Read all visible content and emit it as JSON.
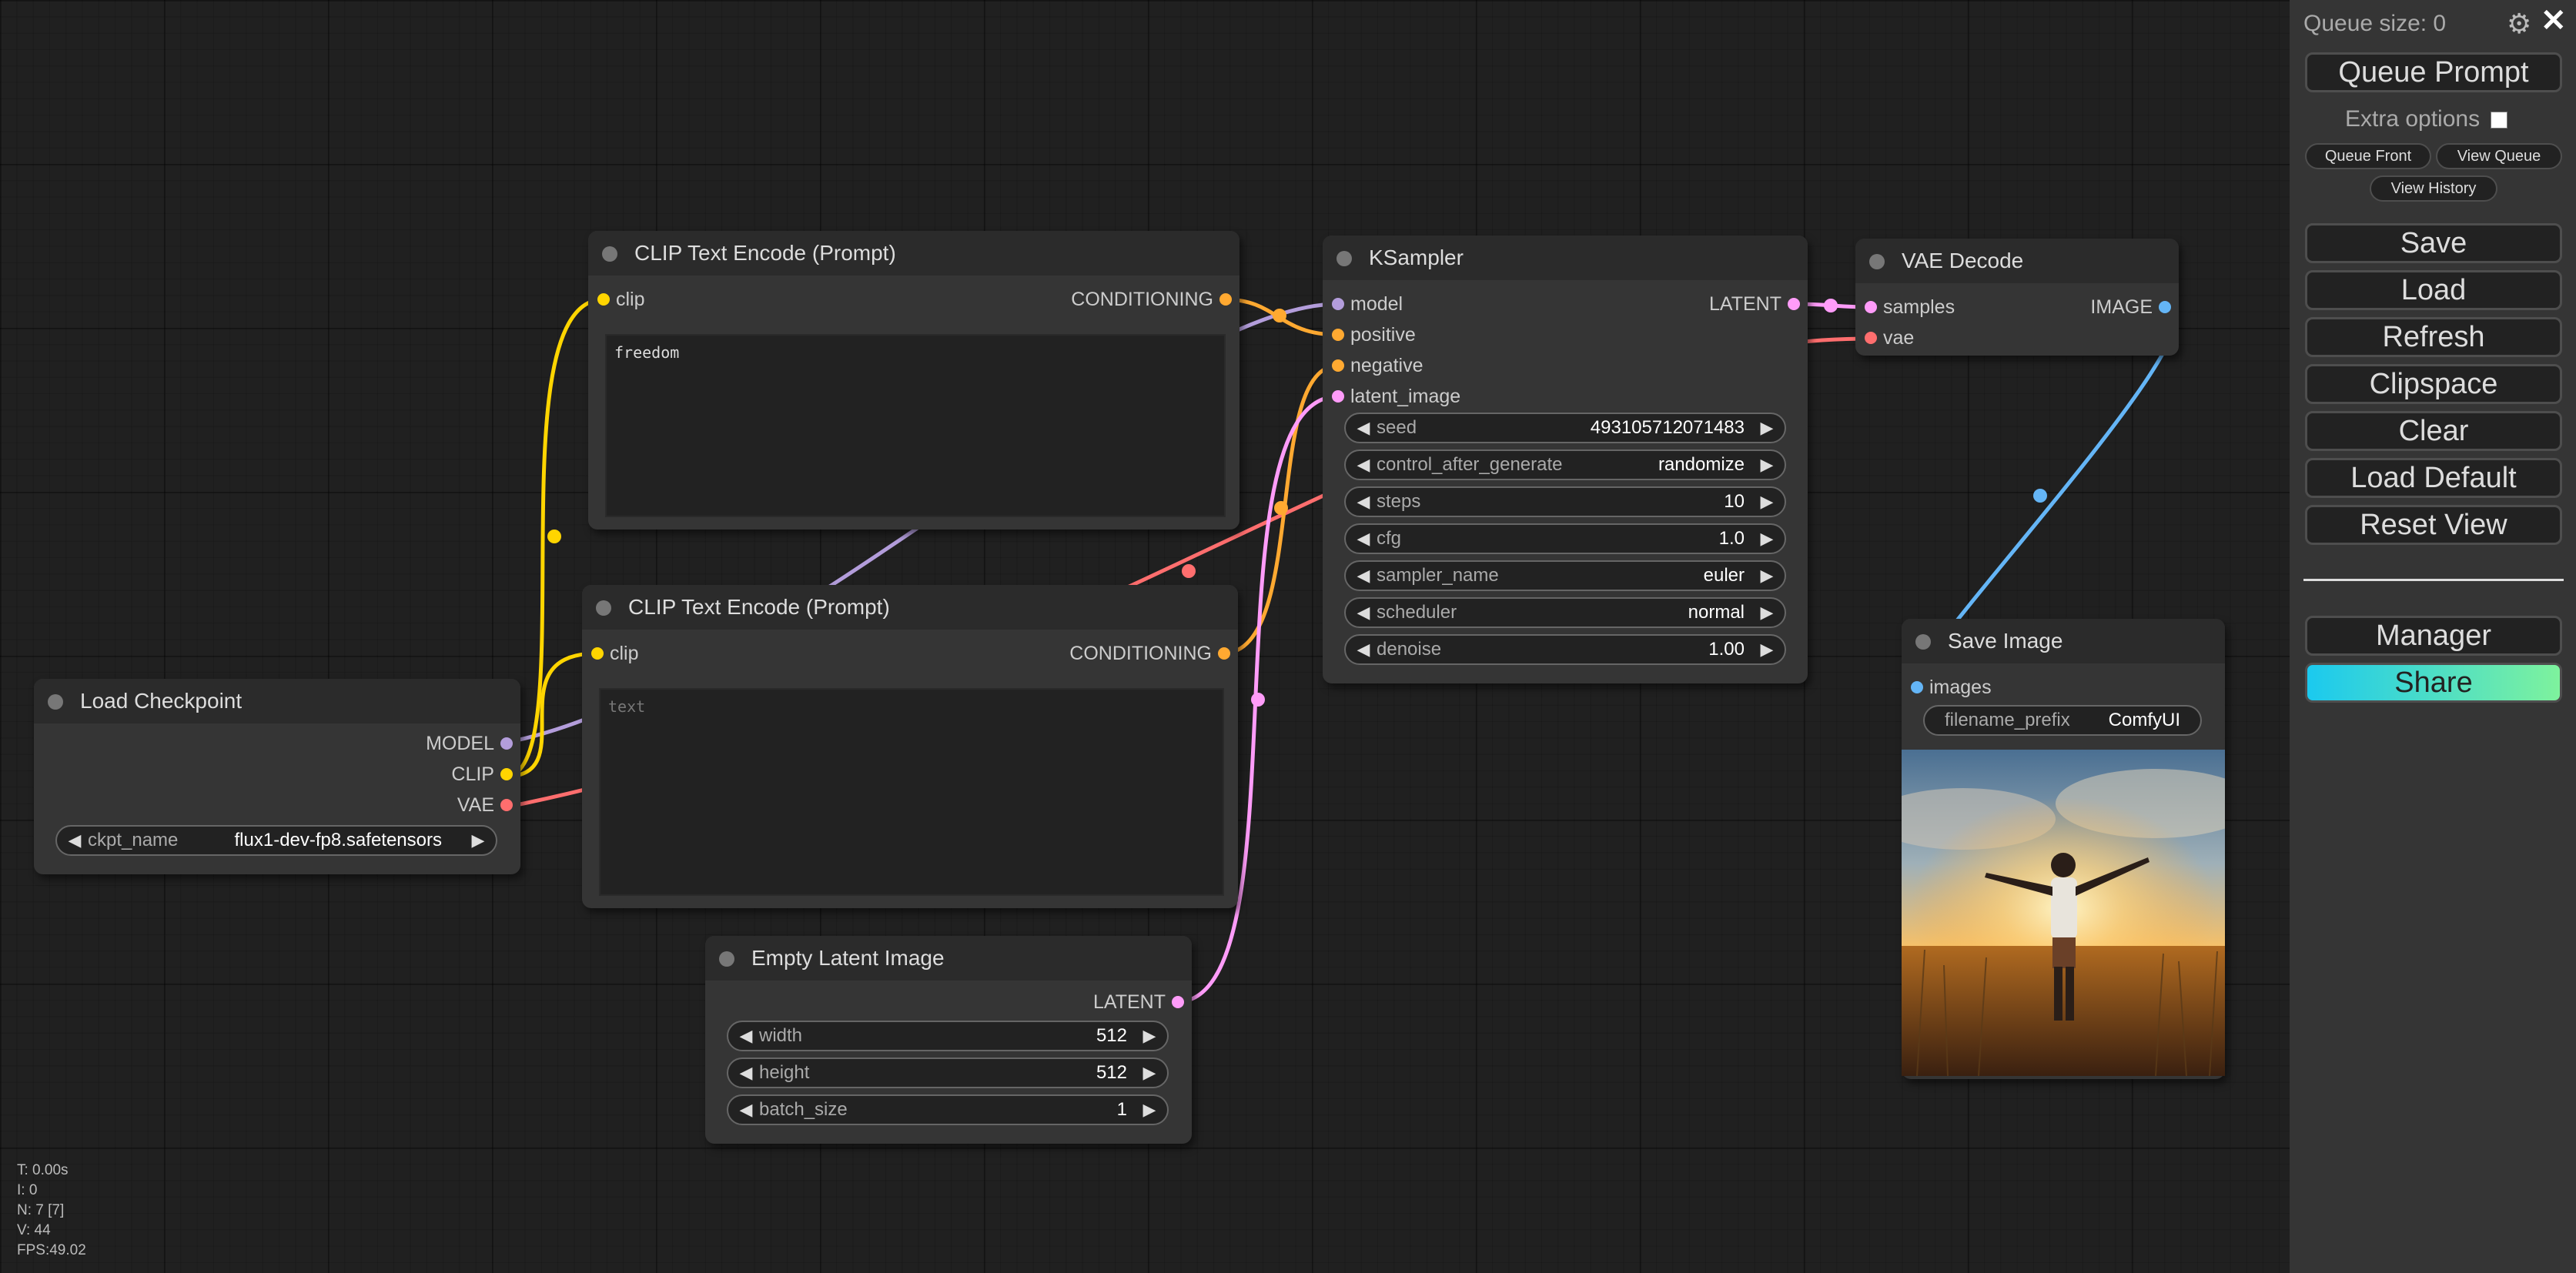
{
  "colors": {
    "canvas_bg": "#202020",
    "node_bg": "#353535",
    "node_title_bg": "#2b2b2b",
    "panel_bg": "#353535",
    "model": "#b39ddb",
    "clip": "#ffd500",
    "vae": "#ff6e6e",
    "conditioning": "#ffa931",
    "latent": "#ff9cf9",
    "image": "#64b5f6",
    "share_gradient_start": "#1bc9ef",
    "share_gradient_end": "#7ef29d"
  },
  "nodes": {
    "clip_top": {
      "title": "CLIP Text Encode (Prompt)",
      "input_clip": "clip",
      "output_conditioning": "CONDITIONING",
      "text": "freedom"
    },
    "clip_bottom": {
      "title": "CLIP Text Encode (Prompt)",
      "input_clip": "clip",
      "output_conditioning": "CONDITIONING",
      "placeholder": "text"
    },
    "load_checkpoint": {
      "title": "Load Checkpoint",
      "output_model": "MODEL",
      "output_clip": "CLIP",
      "output_vae": "VAE",
      "ckpt_label": "ckpt_name",
      "ckpt_value": "flux1-dev-fp8.safetensors"
    },
    "ksampler": {
      "title": "KSampler",
      "input_model": "model",
      "input_positive": "positive",
      "input_negative": "negative",
      "input_latent": "latent_image",
      "output_latent": "LATENT",
      "widgets": [
        {
          "label": "seed",
          "value": "493105712071483"
        },
        {
          "label": "control_after_generate",
          "value": "randomize"
        },
        {
          "label": "steps",
          "value": "10"
        },
        {
          "label": "cfg",
          "value": "1.0"
        },
        {
          "label": "sampler_name",
          "value": "euler"
        },
        {
          "label": "scheduler",
          "value": "normal"
        },
        {
          "label": "denoise",
          "value": "1.00"
        }
      ]
    },
    "vae_decode": {
      "title": "VAE Decode",
      "input_samples": "samples",
      "input_vae": "vae",
      "output_image": "IMAGE"
    },
    "save_image": {
      "title": "Save Image",
      "input_images": "images",
      "prefix_label": "filename_prefix",
      "prefix_value": "ComfyUI"
    },
    "empty_latent": {
      "title": "Empty Latent Image",
      "output_latent": "LATENT",
      "widgets": [
        {
          "label": "width",
          "value": "512"
        },
        {
          "label": "height",
          "value": "512"
        },
        {
          "label": "batch_size",
          "value": "1"
        }
      ]
    }
  },
  "panel": {
    "queue_size": "Queue size: 0",
    "queue_prompt": "Queue Prompt",
    "extra_options": "Extra options",
    "queue_front": "Queue Front",
    "view_queue": "View Queue",
    "view_history": "View History",
    "save": "Save",
    "load": "Load",
    "refresh": "Refresh",
    "clipspace": "Clipspace",
    "clear": "Clear",
    "load_default": "Load Default",
    "reset_view": "Reset View",
    "manager": "Manager",
    "share": "Share",
    "settings_icon": "gear-icon",
    "close_icon": "close-icon"
  },
  "stats": {
    "t": "T: 0.00s",
    "i": "I: 0",
    "n": "N: 7 [7]",
    "v": "V: 44",
    "fps": "FPS:49.02"
  }
}
